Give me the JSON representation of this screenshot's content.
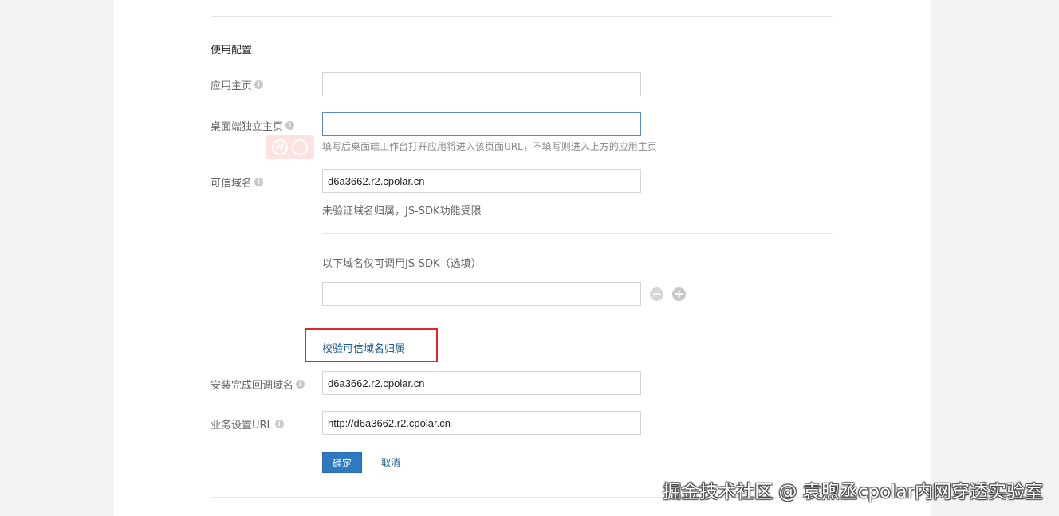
{
  "section": {
    "title": "使用配置"
  },
  "fields": {
    "app_home": {
      "label": "应用主页",
      "value": ""
    },
    "desktop_home": {
      "label": "桌面端独立主页",
      "value": "",
      "hint": "填写后桌面端工作台打开应用将进入该页面URL，不填写则进入上方的应用主页"
    },
    "trusted_domain": {
      "label": "可信域名",
      "value": "d6a3662.r2.cpolar.cn",
      "hint": "未验证域名归属，JS-SDK功能受限"
    },
    "jssdk_domains": {
      "label": "以下域名仅可调用JS-SDK（选填）",
      "value": "",
      "remove_icon": "minus-icon",
      "add_icon": "plus-icon"
    },
    "verify_link": "校验可信域名归属",
    "install_callback": {
      "label": "安装完成回调域名",
      "value": "d6a3662.r2.cpolar.cn"
    },
    "business_url": {
      "label": "业务设置URL",
      "value": "http://d6a3662.r2.cpolar.cn"
    }
  },
  "buttons": {
    "ok": "确定",
    "cancel": "取消"
  },
  "ai_badge": {
    "left": "AI",
    "right": ""
  },
  "watermark": "掘金技术社区 @ 袁煦丞cpolar内网穿透实验室",
  "colors": {
    "primary": "#2f79c0",
    "link": "#1d5e8c",
    "highlight": "#e0262a"
  }
}
